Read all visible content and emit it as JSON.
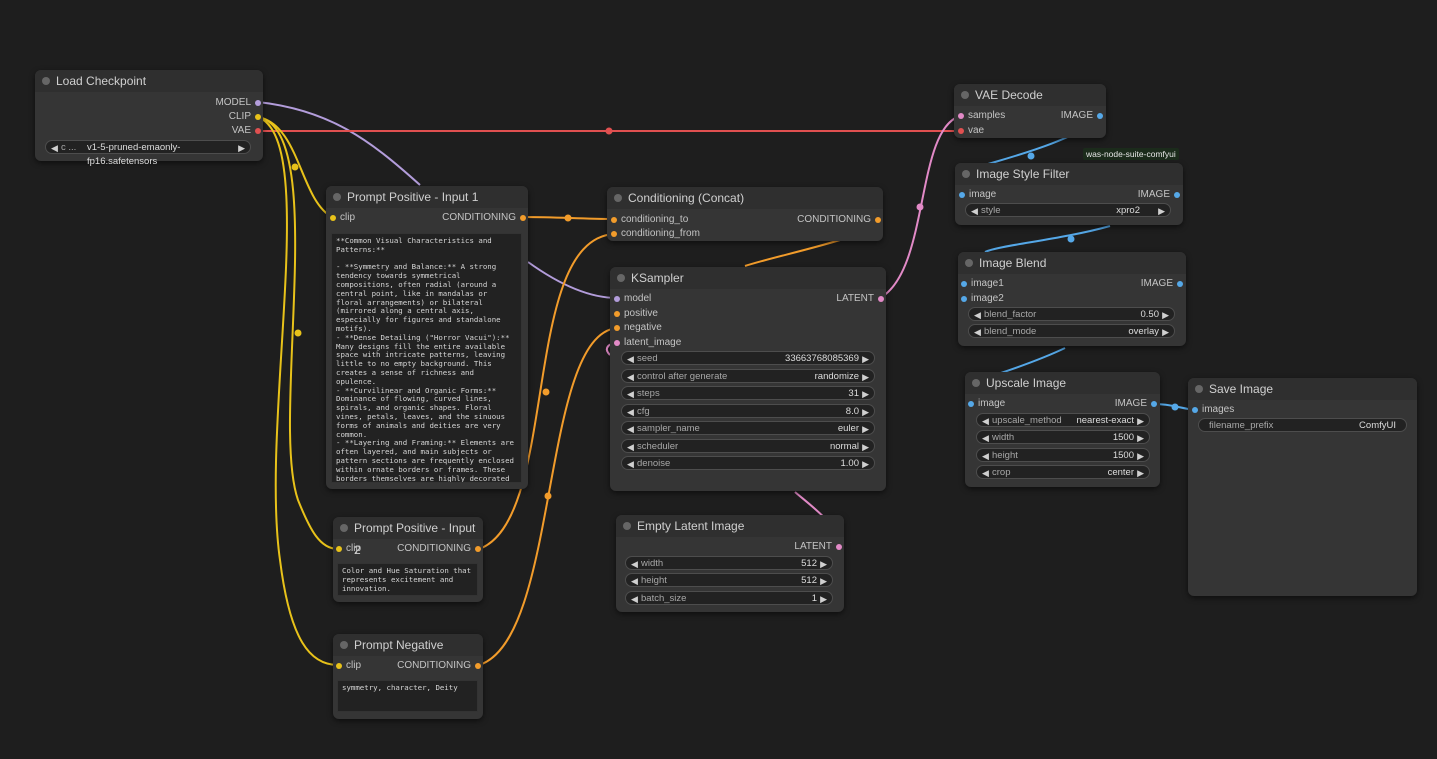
{
  "colors": {
    "clip": "#e8c21a",
    "conditioning": "#f29c2b",
    "latent": "#e28ac7",
    "vae": "#e05050",
    "model": "#b39ddb",
    "image": "#55a8e8"
  },
  "nodes": {
    "load_checkpoint": {
      "title": "Load Checkpoint",
      "out_model": "MODEL",
      "out_clip": "CLIP",
      "out_vae": "VAE",
      "ckpt_prefix": "c ...",
      "ckpt_name": "v1-5-pruned-emaonly-fp16.safetensors"
    },
    "prompt_pos1": {
      "title": "Prompt Positive - Input 1",
      "in_clip": "clip",
      "out": "CONDITIONING",
      "text": "**Common Visual Characteristics and Patterns:**\n\n- **Symmetry and Balance:** A strong tendency towards symmetrical compositions, often radial (around a central point, like in mandalas or floral arrangements) or bilateral (mirrored along a central axis, especially for figures and standalone motifs).\n- **Dense Detailing (\"Horror Vacui\"):** Many designs fill the entire available space with intricate patterns, leaving little to no empty background. This creates a sense of richness and opulence.\n- **Curvilinear and Organic Forms:** Dominance of flowing, curved lines, spirals, and organic shapes. Floral vines, petals, leaves, and the sinuous forms of animals and deities are very common.\n- **Layering and Framing:** Elements are often layered, and main subjects or pattern sections are frequently enclosed within ornate borders or frames. These borders themselves are highly decorated with repeating geometric or floral patterns."
    },
    "prompt_pos2": {
      "title": "Prompt Positive - Input 2",
      "in_clip": "clip",
      "out": "CONDITIONING",
      "text": "Color and Hue Saturation that represents excitement and innovation."
    },
    "prompt_neg": {
      "title": "Prompt Negative",
      "in_clip": "clip",
      "out": "CONDITIONING",
      "text": "symmetry, character, Deity"
    },
    "concat": {
      "title": "Conditioning (Concat)",
      "in1": "conditioning_to",
      "in2": "conditioning_from",
      "out": "CONDITIONING"
    },
    "ksampler": {
      "title": "KSampler",
      "in_model": "model",
      "in_pos": "positive",
      "in_neg": "negative",
      "in_latent": "latent_image",
      "out": "LATENT",
      "widgets": [
        {
          "label": "seed",
          "value": "33663768085369"
        },
        {
          "label": "control after generate",
          "value": "randomize"
        },
        {
          "label": "steps",
          "value": "31"
        },
        {
          "label": "cfg",
          "value": "8.0"
        },
        {
          "label": "sampler_name",
          "value": "euler"
        },
        {
          "label": "scheduler",
          "value": "normal"
        },
        {
          "label": "denoise",
          "value": "1.00"
        }
      ]
    },
    "empty_latent": {
      "title": "Empty Latent Image",
      "out": "LATENT",
      "widgets": [
        {
          "label": "width",
          "value": "512"
        },
        {
          "label": "height",
          "value": "512"
        },
        {
          "label": "batch_size",
          "value": "1"
        }
      ]
    },
    "vae_decode": {
      "title": "VAE Decode",
      "in_samples": "samples",
      "in_vae": "vae",
      "out": "IMAGE"
    },
    "style_filter": {
      "title": "Image Style Filter",
      "in_image": "image",
      "out": "IMAGE",
      "style_label": "style",
      "style_value": "xpro2",
      "badge": "was-node-suite-comfyui"
    },
    "image_blend": {
      "title": "Image Blend",
      "in1": "image1",
      "in2": "image2",
      "out": "IMAGE",
      "widgets": [
        {
          "label": "blend_factor",
          "value": "0.50"
        },
        {
          "label": "blend_mode",
          "value": "overlay"
        }
      ]
    },
    "upscale": {
      "title": "Upscale Image",
      "in_image": "image",
      "out": "IMAGE",
      "widgets": [
        {
          "label": "upscale_method",
          "value": "nearest-exact"
        },
        {
          "label": "width",
          "value": "1500"
        },
        {
          "label": "height",
          "value": "1500"
        },
        {
          "label": "crop",
          "value": "center"
        }
      ]
    },
    "save_image": {
      "title": "Save Image",
      "in_images": "images",
      "prefix_label": "filename_prefix",
      "prefix_value": "ComfyUI"
    }
  }
}
